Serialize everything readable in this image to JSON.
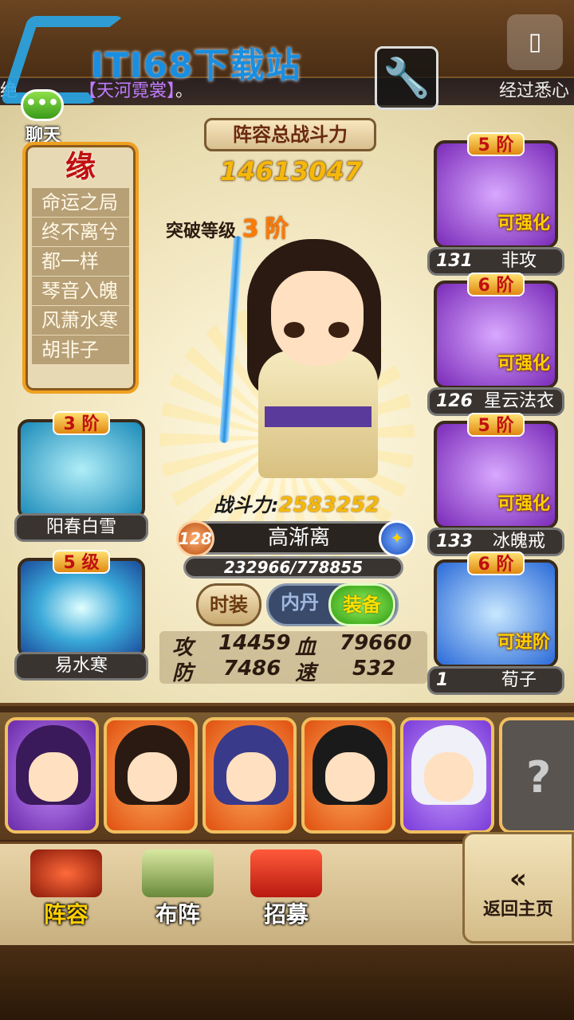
{
  "watermark": {
    "text": "ITI68下载站"
  },
  "marquee": {
    "left_text": "绝",
    "highlight": "【天河霓裳】",
    "after": "。",
    "right_text": "经过悉心"
  },
  "chat": {
    "icon_text": "•••",
    "label": "聊天"
  },
  "fate": {
    "title": "缘",
    "items": [
      "命运之局",
      "终不离兮",
      "都一样",
      "琴音入魄",
      "风萧水寒",
      "胡非子"
    ]
  },
  "skills": [
    {
      "badge": "3 阶",
      "name": "阳春白雪"
    },
    {
      "badge": "5 级",
      "name": "易水寒"
    }
  ],
  "lineup": {
    "title": "阵容总战斗力",
    "value": "14613047"
  },
  "breakthrough": {
    "label": "突破等级",
    "level": "3",
    "unit": "阶"
  },
  "hero": {
    "combat_label": "战斗力:",
    "combat_value": "2583252",
    "level": "128",
    "name": "高渐离",
    "exp": "232966/778855"
  },
  "tabs": {
    "fashion": "时装",
    "dan": "内丹",
    "equip": "装备"
  },
  "stats": {
    "atk_label": "攻",
    "atk": "14459",
    "hp_label": "血",
    "hp": "79660",
    "def_label": "防",
    "def": "7486",
    "spd_label": "速",
    "spd": "532"
  },
  "equipment": [
    {
      "badge": "5 阶",
      "status": "可强化",
      "num": "131",
      "name": "非攻"
    },
    {
      "badge": "6 阶",
      "status": "可强化",
      "num": "126",
      "name": "星云法衣"
    },
    {
      "badge": "5 阶",
      "status": "可强化",
      "num": "133",
      "name": "冰魄戒"
    },
    {
      "badge": "6 阶",
      "status": "可进阶",
      "num": "1",
      "name": "荀子"
    }
  ],
  "locked_slot": "?",
  "nav": {
    "lineup": "阵容",
    "formation": "布阵",
    "recruit": "招募",
    "back_arrow": "«",
    "back": "返回主页"
  },
  "colors": {
    "accent": "#f5b80a",
    "badge_red": "#c01010",
    "equip_purple": "#7a2ab8"
  }
}
